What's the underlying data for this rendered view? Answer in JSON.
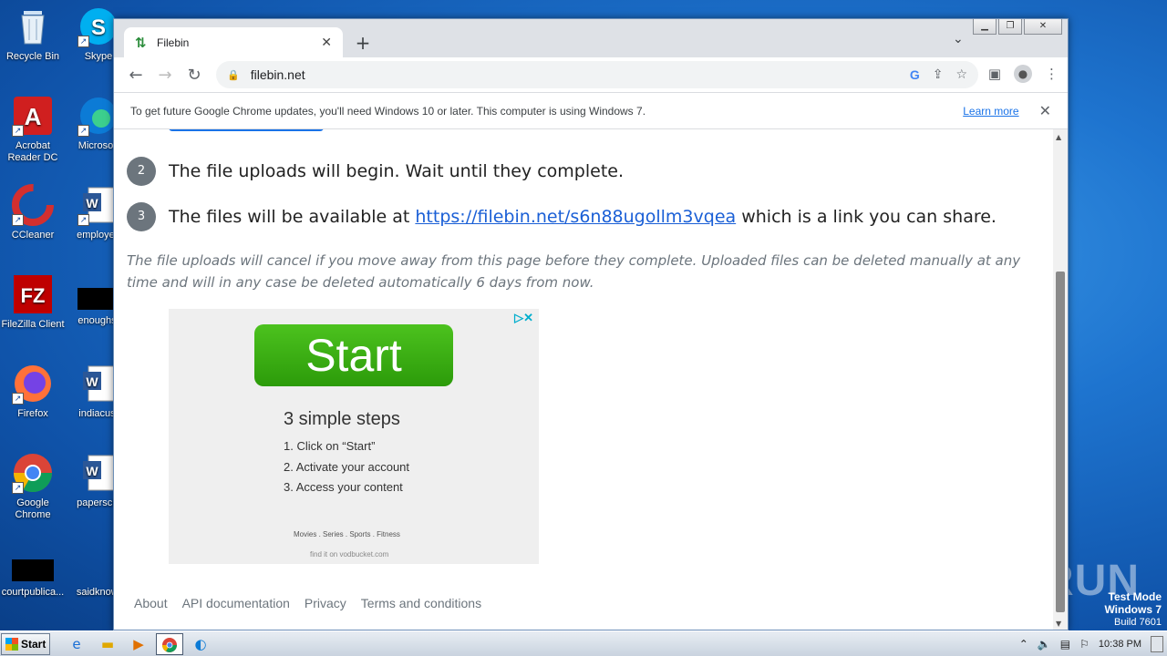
{
  "desktop": {
    "icons_col1": [
      {
        "label": "Recycle Bin",
        "icon": "recycle-bin-icon",
        "glyph": "🗑"
      },
      {
        "label": "Acrobat Reader DC",
        "icon": "acrobat-icon",
        "glyph": "A"
      },
      {
        "label": "CCleaner",
        "icon": "ccleaner-icon",
        "glyph": "C"
      },
      {
        "label": "FileZilla Client",
        "icon": "filezilla-icon",
        "glyph": "FZ"
      },
      {
        "label": "Firefox",
        "icon": "firefox-icon",
        "glyph": "🦊"
      },
      {
        "label": "Google Chrome",
        "icon": "chrome-icon",
        "glyph": "◉"
      },
      {
        "label": "courtpublica...",
        "icon": "document-icon",
        "glyph": ""
      }
    ],
    "icons_col2": [
      {
        "label": "Skype",
        "icon": "skype-icon",
        "glyph": "S"
      },
      {
        "label": "Microsoft",
        "icon": "edge-icon",
        "glyph": "e"
      },
      {
        "label": "employee",
        "icon": "word-doc-icon",
        "glyph": "W"
      },
      {
        "label": "enoughst",
        "icon": "document-icon",
        "glyph": ""
      },
      {
        "label": "indiacust",
        "icon": "word-doc-icon",
        "glyph": "W"
      },
      {
        "label": "papersclu",
        "icon": "word-doc-icon",
        "glyph": "W"
      },
      {
        "label": "saidknowl",
        "icon": "document-icon",
        "glyph": ""
      }
    ],
    "watermark": "ANY RUN",
    "test_mode": {
      "line1": "Test Mode",
      "line2": "Windows 7",
      "line3": "Build 7601"
    }
  },
  "browser": {
    "tab": {
      "title": "Filebin",
      "favicon": "filebin-icon"
    },
    "url": "filebin.net",
    "infobar": {
      "message": "To get future Google Chrome updates, you'll need Windows 10 or later. This computer is using Windows 7.",
      "link": "Learn more"
    }
  },
  "page": {
    "steps": [
      {
        "num": "2",
        "text": "The file uploads will begin. Wait until they complete."
      },
      {
        "num": "3",
        "text_before": "The files will be available at ",
        "link": "https://filebin.net/s6n88ugollm3vqea",
        "text_after": " which is a link you can share."
      }
    ],
    "note": "The file uploads will cancel if you move away from this page before they complete. Uploaded files can be deleted manually at any time and will in any case be deleted automatically 6 days from now.",
    "ad": {
      "button": "Start",
      "heading": "3 simple steps",
      "items": [
        "1. Click on “Start”",
        "2. Activate your account",
        "3. Access your content"
      ],
      "categories": "Movies . Series . Sports . Fitness",
      "footer": "find it on vodbucket.com"
    },
    "footer_links": [
      "About",
      "API documentation",
      "Privacy",
      "Terms and conditions"
    ]
  },
  "taskbar": {
    "start_label": "Start",
    "apps": [
      "internet-explorer-icon",
      "explorer-folder-icon",
      "media-player-icon",
      "chrome-icon",
      "edge-icon"
    ],
    "clock": "10:38 PM"
  },
  "colors": {
    "link": "#1a5fd6",
    "accent": "#1a73e8",
    "ad_green": "#3caf14"
  }
}
